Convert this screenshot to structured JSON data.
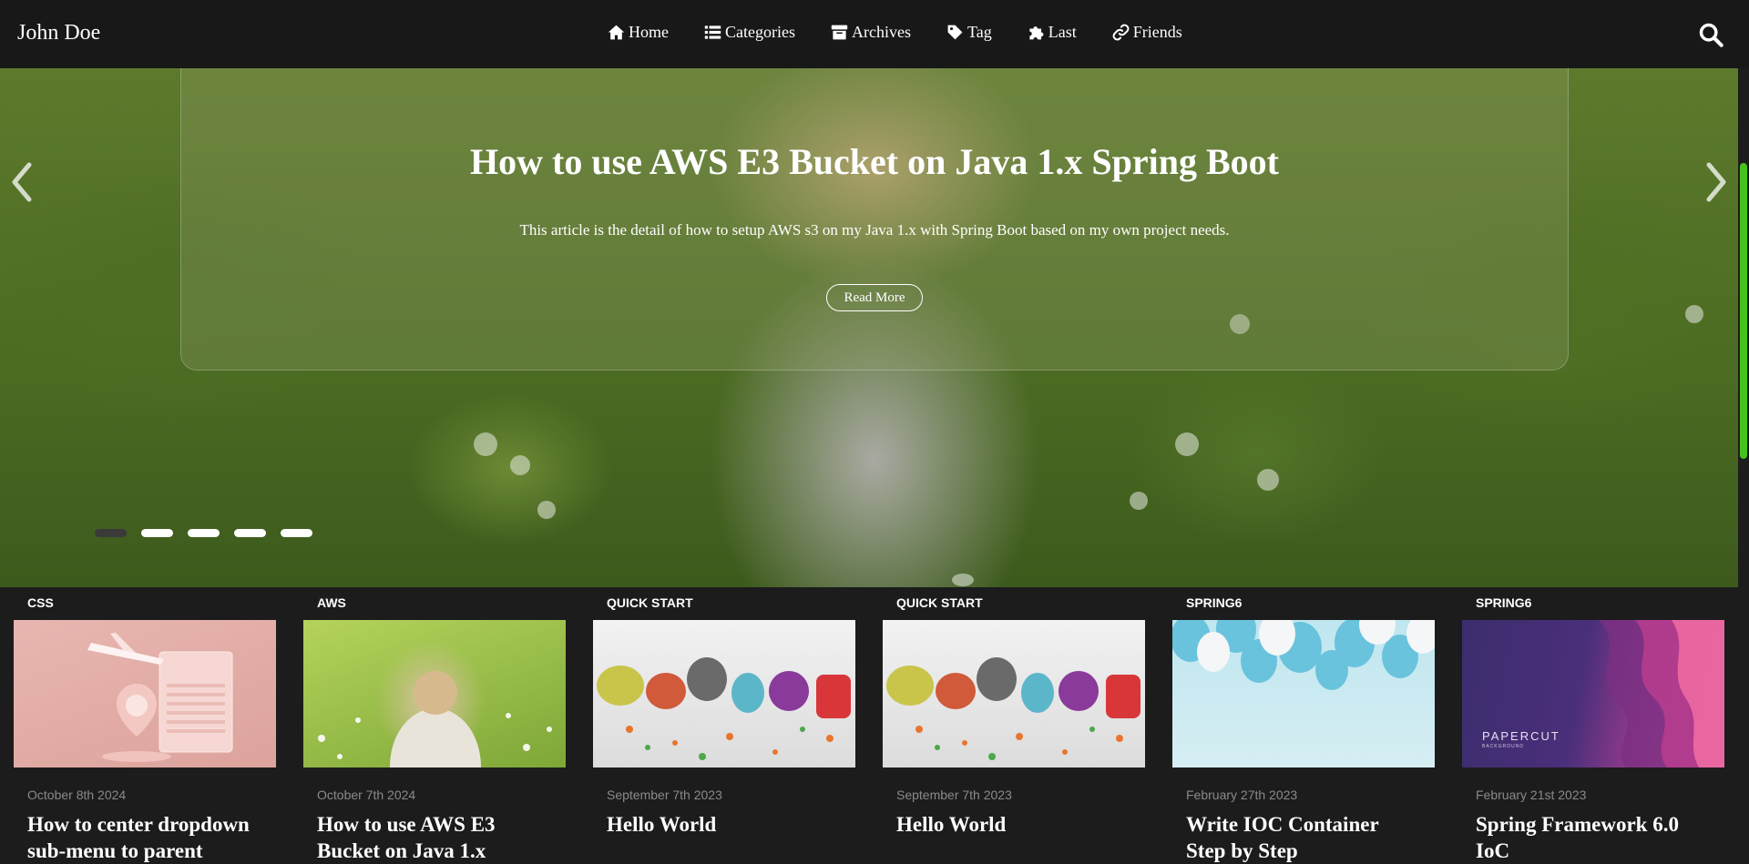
{
  "brand": "John Doe",
  "nav": {
    "items": [
      {
        "label": "Home",
        "icon": "home-icon"
      },
      {
        "label": "Categories",
        "icon": "list-icon"
      },
      {
        "label": "Archives",
        "icon": "archive-icon"
      },
      {
        "label": "Tag",
        "icon": "tag-icon"
      },
      {
        "label": "Last",
        "icon": "puzzle-icon"
      },
      {
        "label": "Friends",
        "icon": "link-icon"
      }
    ],
    "search_icon": "search-icon"
  },
  "hero": {
    "title": "How to use AWS E3 Bucket on Java 1.x Spring Boot",
    "description": "This article is the detail of how to setup AWS s3 on my Java 1.x with Spring Boot based on my own project needs.",
    "read_more": "Read More",
    "slide_count": 5,
    "active_slide": 1
  },
  "colors": {
    "nav_bg": "#181818",
    "page_bg": "#1c1c1c",
    "scrollbar": "#46c21e",
    "date_text": "#8a8a8a"
  },
  "cards": [
    {
      "category": "CSS",
      "date": "October 8th 2024",
      "title": "How to center dropdown sub-menu to parent"
    },
    {
      "category": "AWS",
      "date": "October 7th 2024",
      "title": "How to use AWS E3 Bucket on Java 1.x"
    },
    {
      "category": "QUICK START",
      "date": "September 7th 2023",
      "title": "Hello World"
    },
    {
      "category": "QUICK START",
      "date": "September 7th 2023",
      "title": "Hello World"
    },
    {
      "category": "SPRING6",
      "date": "February 27th 2023",
      "title": "Write IOC Container Step by Step"
    },
    {
      "category": "SPRING6",
      "date": "February 21st 2023",
      "title": "Spring Framework 6.0 IoC"
    }
  ],
  "card_images": {
    "papercut_title": "PAPERCUT",
    "papercut_sub": "BACKGROUND"
  }
}
